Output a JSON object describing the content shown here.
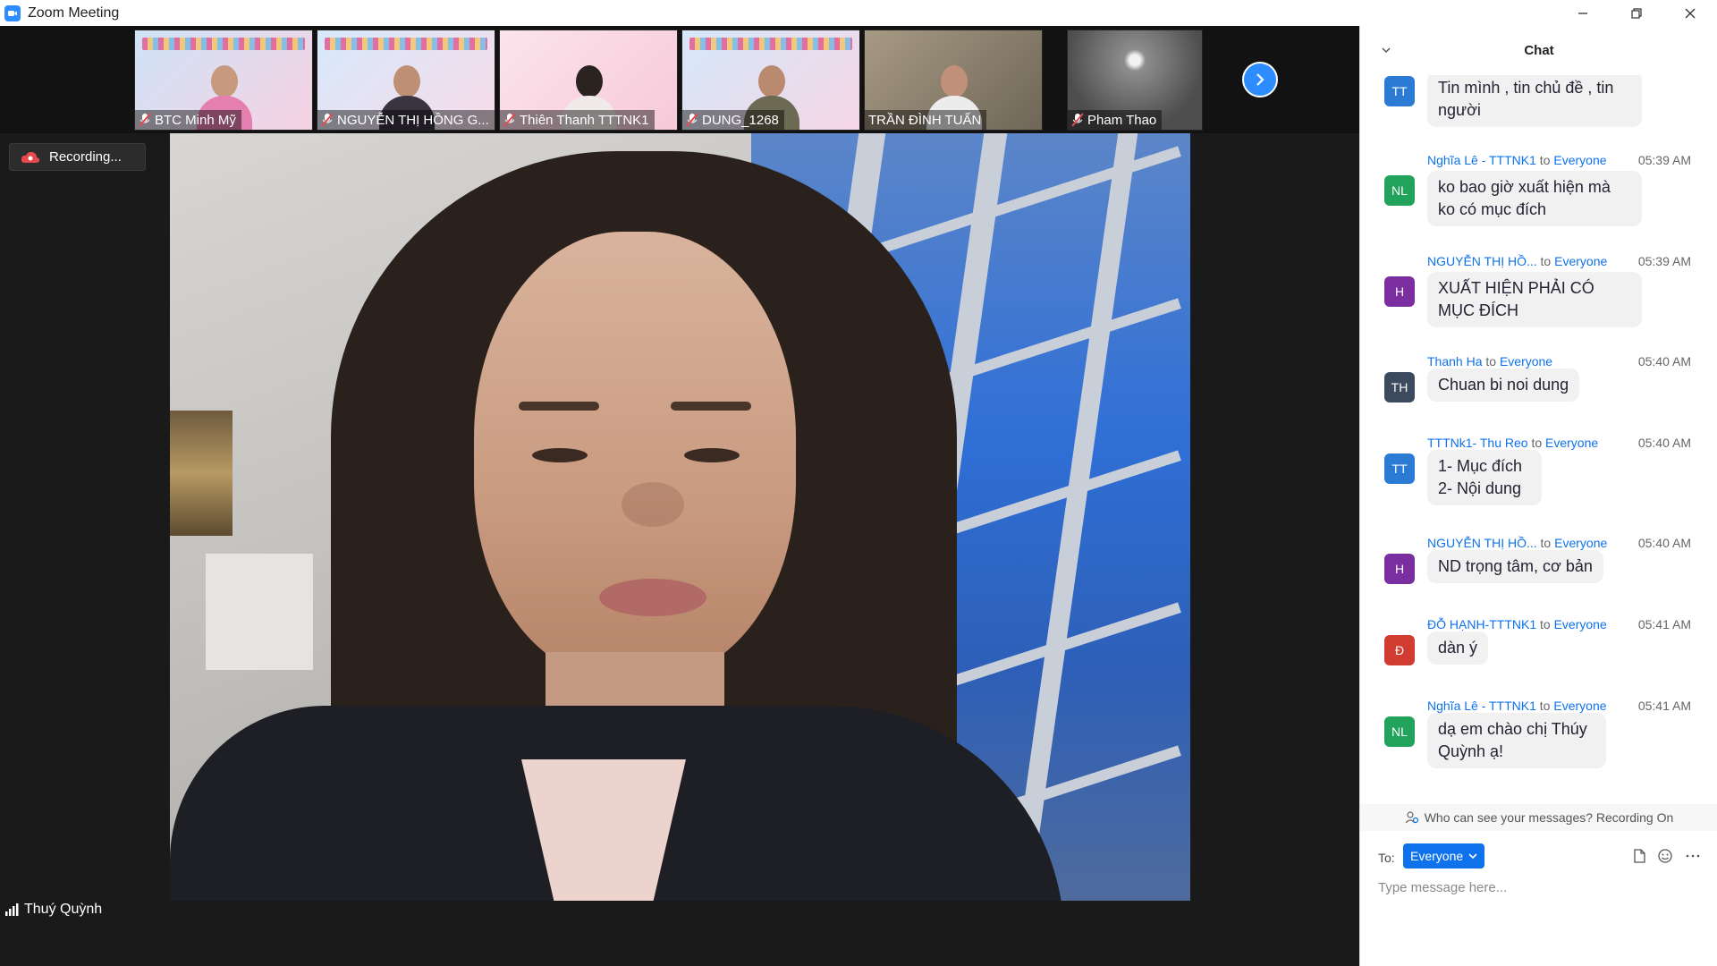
{
  "window": {
    "title": "Zoom Meeting"
  },
  "participants": [
    {
      "name": "BTC Minh Mỹ"
    },
    {
      "name": "NGUYỄN THỊ HỒNG G..."
    },
    {
      "name": "Thiên Thanh TTTNK1"
    },
    {
      "name": "DUNG_1268"
    },
    {
      "name": "TRẦN ĐÌNH TUẤN"
    },
    {
      "name": "Pham Thao"
    }
  ],
  "recording": {
    "label": "Recording..."
  },
  "active_speaker": {
    "name": "Thuý Quỳnh"
  },
  "chat": {
    "title": "Chat",
    "messages": [
      {
        "sender": "",
        "to": "",
        "target": "",
        "time": "",
        "avatar": "TT",
        "avatar_color": "#2b7bd5",
        "text": "Tin mình , tin chủ đề , tin người"
      },
      {
        "sender": "Nghĩa Lê - TTTNK1",
        "to": "to",
        "target": "Everyone",
        "time": "05:39 AM",
        "avatar": "NL",
        "avatar_color": "#22a35b",
        "text": "ko bao giờ xuất hiện mà ko có mục đích"
      },
      {
        "sender": "NGUYỄN THỊ HỒ...",
        "to": "to",
        "target": "Everyone",
        "time": "05:39 AM",
        "avatar": "H",
        "avatar_color": "#7b2ea0",
        "text": "XUẤT HIỆN PHẢI CÓ MỤC ĐÍCH"
      },
      {
        "sender": "Thanh Ha",
        "to": "to",
        "target": "Everyone",
        "time": "05:40 AM",
        "avatar": "TH",
        "avatar_color": "#3b4a5e",
        "text": "Chuan bi noi dung"
      },
      {
        "sender": "TTTNk1- Thu Reo",
        "to": "to",
        "target": "Everyone",
        "time": "05:40 AM",
        "avatar": "TT",
        "avatar_color": "#2b7bd5",
        "text": "1- Mục đích 2- Nội dung"
      },
      {
        "sender": "NGUYỄN THỊ HỒ...",
        "to": "to",
        "target": "Everyone",
        "time": "05:40 AM",
        "avatar": "H",
        "avatar_color": "#7b2ea0",
        "text": "ND trọng tâm, cơ bản"
      },
      {
        "sender": "ĐỖ HẠNH-TTTNK1",
        "to": "to",
        "target": "Everyone",
        "time": "05:41 AM",
        "avatar": "Đ",
        "avatar_color": "#d23b2f",
        "text": "dàn ý"
      },
      {
        "sender": "Nghĩa Lê - TTTNK1",
        "to": "to",
        "target": "Everyone",
        "time": "05:41 AM",
        "avatar": "NL",
        "avatar_color": "#22a35b",
        "text": "dạ em chào chị Thúy Quỳnh ạ!"
      }
    ],
    "notice": "Who can see your messages? Recording On",
    "to_label": "To:",
    "to_value": "Everyone",
    "input_placeholder": "Type message here..."
  },
  "colors": {
    "accent": "#0e72ed",
    "zoom_blue": "#2d8cff",
    "muted_red": "#e5484d"
  }
}
